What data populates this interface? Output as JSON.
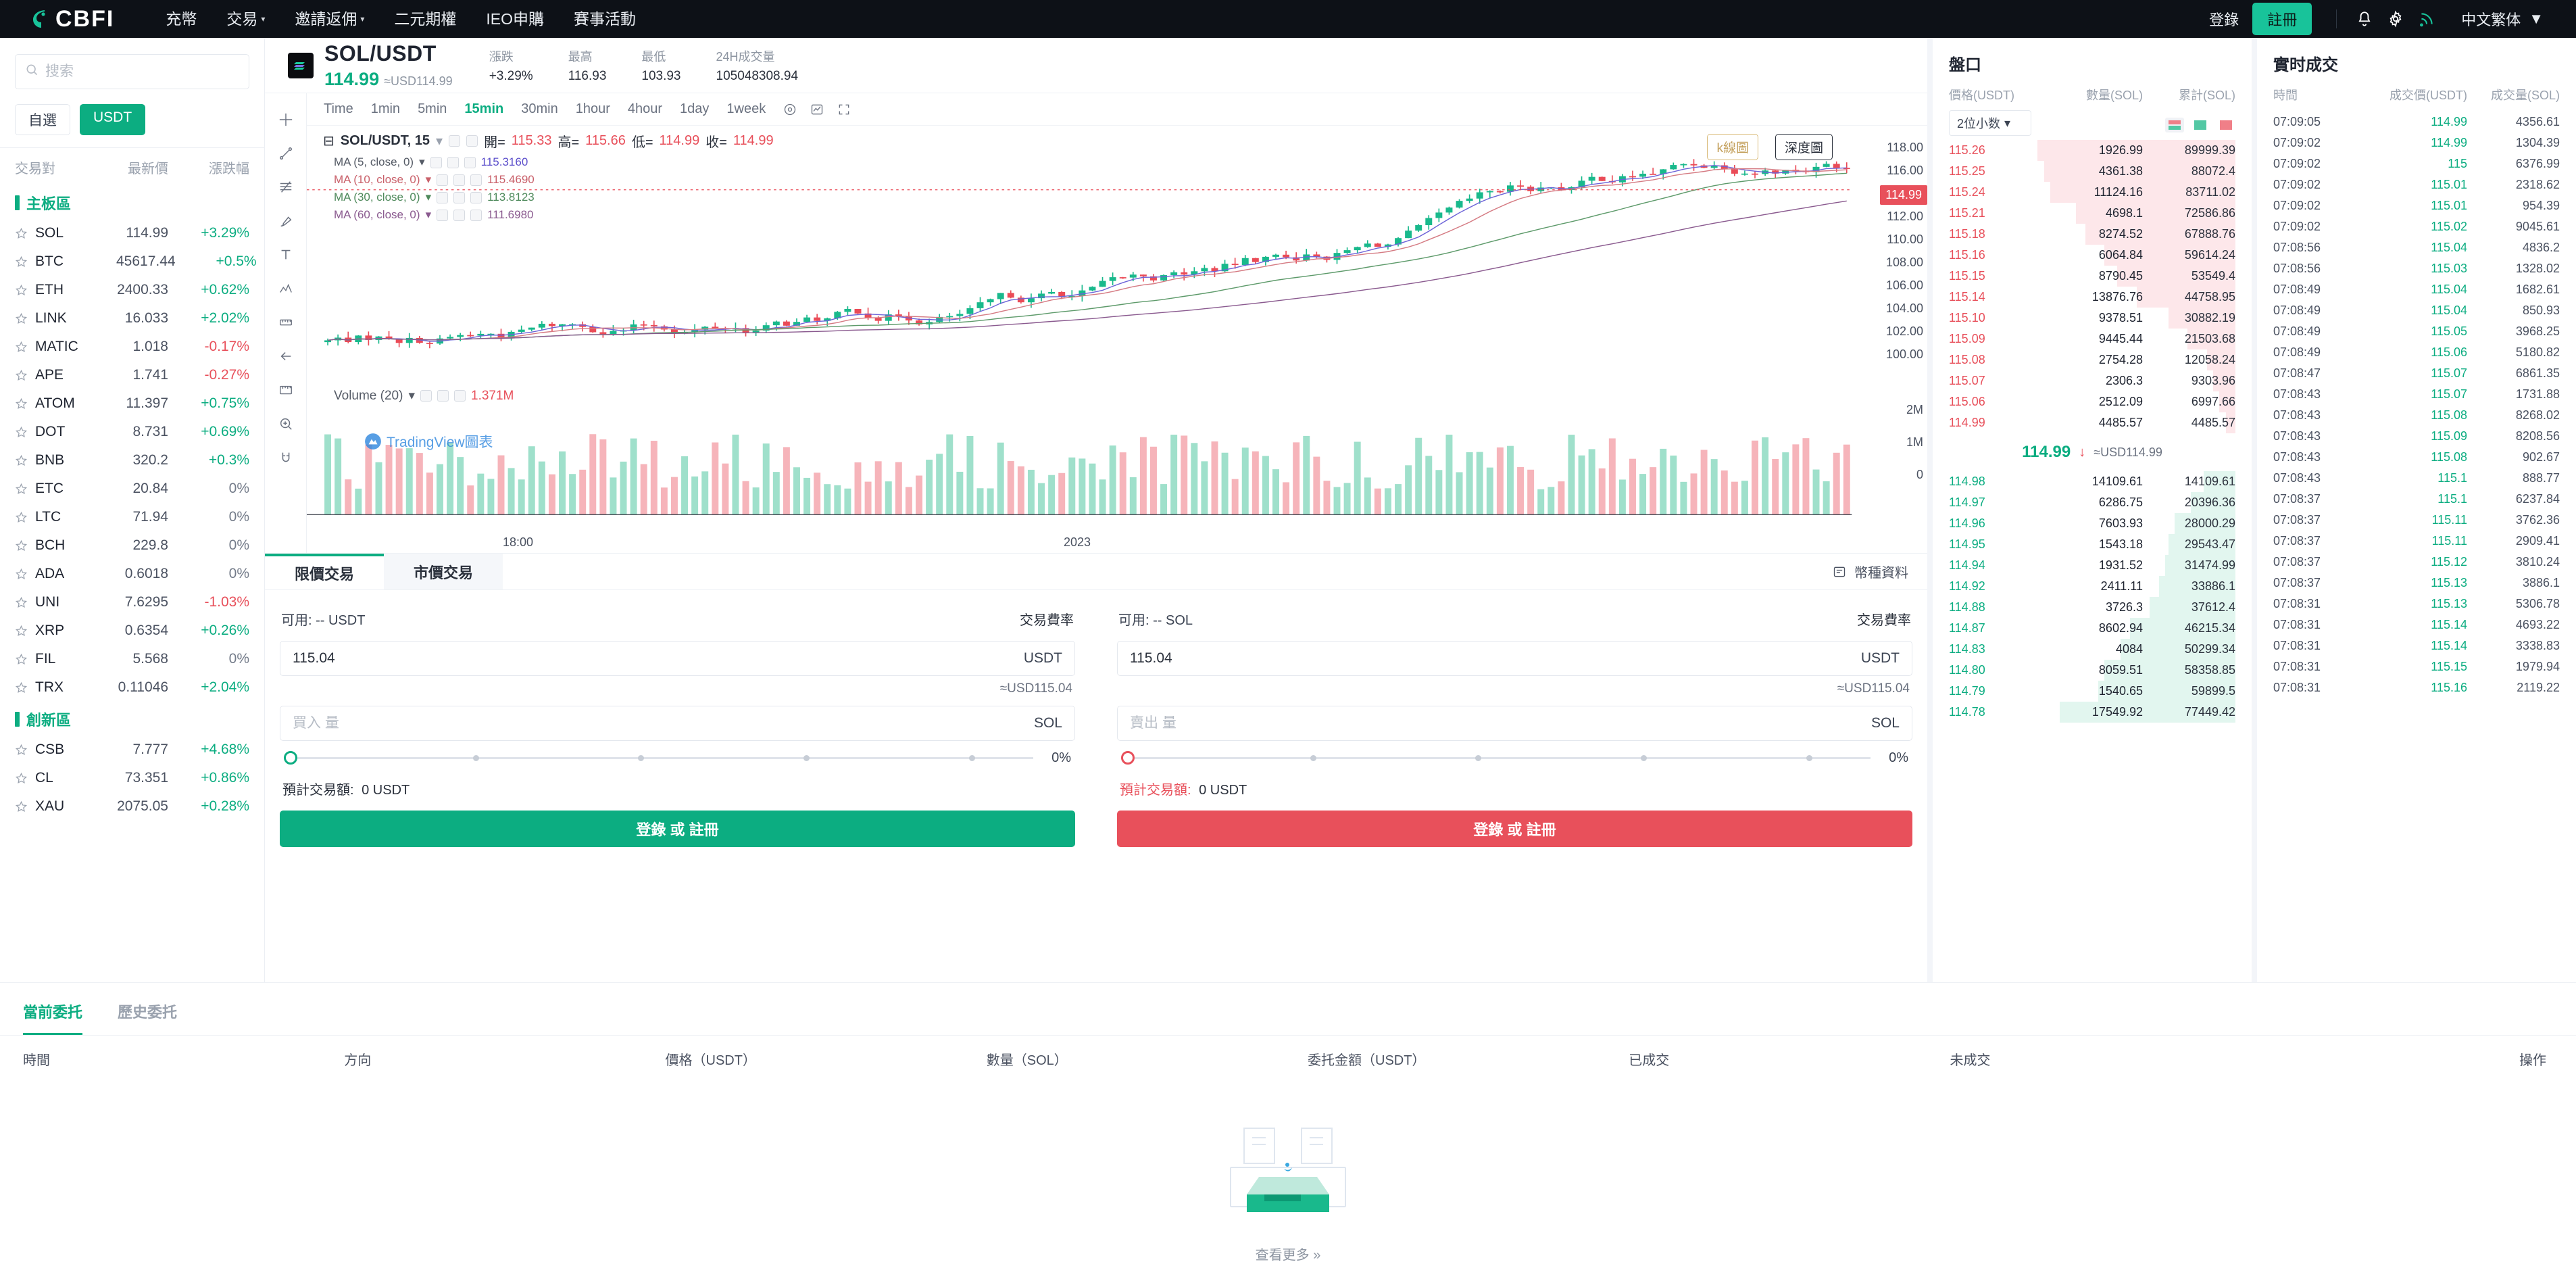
{
  "nav": {
    "brand": "CBFI",
    "items": [
      {
        "label": "充幣",
        "caret": false
      },
      {
        "label": "交易",
        "caret": true
      },
      {
        "label": "邀請返佣",
        "caret": true
      },
      {
        "label": "二元期權",
        "caret": false
      },
      {
        "label": "IEO申購",
        "caret": false
      },
      {
        "label": "賽事活動",
        "caret": false
      }
    ],
    "login": "登錄",
    "register": "註冊",
    "language": "中文繁体",
    "icons": [
      "bell-icon",
      "gear-icon",
      "rss-icon"
    ]
  },
  "sidebar": {
    "search_placeholder": "搜索",
    "chips": [
      {
        "label": "自選",
        "active": false
      },
      {
        "label": "USDT",
        "active": true
      }
    ],
    "columns": {
      "pair": "交易對",
      "price": "最新價",
      "change": "漲跌幅"
    },
    "groups": [
      {
        "name": "主板區",
        "coins": [
          {
            "symbol": "SOL",
            "price": "114.99",
            "change": "+3.29%",
            "dir": "up"
          },
          {
            "symbol": "BTC",
            "price": "45617.44",
            "change": "+0.5%",
            "dir": "up"
          },
          {
            "symbol": "ETH",
            "price": "2400.33",
            "change": "+0.62%",
            "dir": "up"
          },
          {
            "symbol": "LINK",
            "price": "16.033",
            "change": "+2.02%",
            "dir": "up"
          },
          {
            "symbol": "MATIC",
            "price": "1.018",
            "change": "-0.17%",
            "dir": "down"
          },
          {
            "symbol": "APE",
            "price": "1.741",
            "change": "-0.27%",
            "dir": "down"
          },
          {
            "symbol": "ATOM",
            "price": "11.397",
            "change": "+0.75%",
            "dir": "up"
          },
          {
            "symbol": "DOT",
            "price": "8.731",
            "change": "+0.69%",
            "dir": "up"
          },
          {
            "symbol": "BNB",
            "price": "320.2",
            "change": "+0.3%",
            "dir": "up"
          },
          {
            "symbol": "ETC",
            "price": "20.84",
            "change": "0%",
            "dir": "flat"
          },
          {
            "symbol": "LTC",
            "price": "71.94",
            "change": "0%",
            "dir": "flat"
          },
          {
            "symbol": "BCH",
            "price": "229.8",
            "change": "0%",
            "dir": "flat"
          },
          {
            "symbol": "ADA",
            "price": "0.6018",
            "change": "0%",
            "dir": "flat"
          },
          {
            "symbol": "UNI",
            "price": "7.6295",
            "change": "-1.03%",
            "dir": "down"
          },
          {
            "symbol": "XRP",
            "price": "0.6354",
            "change": "+0.26%",
            "dir": "up"
          },
          {
            "symbol": "FIL",
            "price": "5.568",
            "change": "0%",
            "dir": "flat"
          },
          {
            "symbol": "TRX",
            "price": "0.11046",
            "change": "+2.04%",
            "dir": "up"
          }
        ]
      },
      {
        "name": "創新區",
        "coins": [
          {
            "symbol": "CSB",
            "price": "7.777",
            "change": "+4.68%",
            "dir": "up"
          },
          {
            "symbol": "CL",
            "price": "73.351",
            "change": "+0.86%",
            "dir": "up"
          },
          {
            "symbol": "XAU",
            "price": "2075.05",
            "change": "+0.28%",
            "dir": "up"
          }
        ]
      }
    ]
  },
  "ticker": {
    "pair": "SOL/USDT",
    "price": "114.99",
    "approx": "≈USD114.99",
    "stats": [
      {
        "label": "漲跌",
        "value": "+3.29%",
        "dir": "up"
      },
      {
        "label": "最高",
        "value": "116.93",
        "dir": "plain"
      },
      {
        "label": "最低",
        "value": "103.93",
        "dir": "plain"
      },
      {
        "label": "24H成交量",
        "value": "105048308.94",
        "dir": "plain"
      }
    ]
  },
  "chart": {
    "timeframes": [
      {
        "label": "Time",
        "active": false
      },
      {
        "label": "1min",
        "active": false
      },
      {
        "label": "5min",
        "active": false
      },
      {
        "label": "15min",
        "active": true
      },
      {
        "label": "30min",
        "active": false
      },
      {
        "label": "1hour",
        "active": false
      },
      {
        "label": "4hour",
        "active": false
      },
      {
        "label": "1day",
        "active": false
      },
      {
        "label": "1week",
        "active": false
      }
    ],
    "symbol_label": "SOL/USDT, 15",
    "ohlc": {
      "open_label": "開=",
      "open": "115.33",
      "high_label": "高=",
      "high": "115.66",
      "low_label": "低=",
      "low": "114.99",
      "close_label": "收=",
      "close": "114.99"
    },
    "ma": [
      {
        "label": "MA (5, close, 0)",
        "value": "115.3160"
      },
      {
        "label": "MA (10, close, 0)",
        "value": "115.4690"
      },
      {
        "label": "MA (30, close, 0)",
        "value": "113.8123"
      },
      {
        "label": "MA (60, close, 0)",
        "value": "111.6980"
      }
    ],
    "volume": {
      "label": "Volume (20)",
      "value": "1.371M"
    },
    "watermark": "TradingView圖表",
    "kline_btn": "k線圖",
    "depth_btn": "深度圖",
    "price_ticks": [
      "118.00",
      "116.00",
      "114.00",
      "112.00",
      "110.00",
      "108.00",
      "106.00",
      "104.00",
      "102.00",
      "100.00"
    ],
    "current_price_tag": "114.99",
    "volume_ticks": [
      "2M",
      "1M",
      "0"
    ],
    "time_ticks": [
      "18:00",
      "2023"
    ]
  },
  "trade": {
    "tabs": [
      {
        "label": "限價交易",
        "active": true
      },
      {
        "label": "市價交易",
        "active": false
      }
    ],
    "fee_link": "幣種資料",
    "buy": {
      "avail_label": "可用: -- USDT",
      "fee_label": "交易費率",
      "price_value": "115.04",
      "price_unit": "USDT",
      "approx": "≈USD115.04",
      "amount_placeholder": "買入 量",
      "amount_unit": "SOL",
      "pct": "0%",
      "est_label": "預計交易額:",
      "est_value": "0 USDT",
      "cta": "登錄 或 註冊"
    },
    "sell": {
      "avail_label": "可用: -- SOL",
      "fee_label": "交易費率",
      "price_value": "115.04",
      "price_unit": "USDT",
      "approx": "≈USD115.04",
      "amount_placeholder": "賣出 量",
      "amount_unit": "SOL",
      "pct": "0%",
      "est_label": "預計交易額:",
      "est_value": "0 USDT",
      "cta": "登錄 或 註冊"
    }
  },
  "orderbook": {
    "title": "盤口",
    "columns": {
      "price": "價格(USDT)",
      "amount": "數量(SOL)",
      "total": "累計(SOL)"
    },
    "precision": "2位小数",
    "asks": [
      {
        "price": "115.26",
        "amount": "1926.99",
        "total": "89999.39",
        "w": 62
      },
      {
        "price": "115.25",
        "amount": "4361.38",
        "total": "88072.4",
        "w": 60
      },
      {
        "price": "115.24",
        "amount": "11124.16",
        "total": "83711.02",
        "w": 58
      },
      {
        "price": "115.21",
        "amount": "4698.1",
        "total": "72586.86",
        "w": 50
      },
      {
        "price": "115.18",
        "amount": "8274.52",
        "total": "67888.76",
        "w": 47
      },
      {
        "price": "115.16",
        "amount": "6064.84",
        "total": "59614.24",
        "w": 41
      },
      {
        "price": "115.15",
        "amount": "8790.45",
        "total": "53549.4",
        "w": 37
      },
      {
        "price": "115.14",
        "amount": "13876.76",
        "total": "44758.95",
        "w": 31
      },
      {
        "price": "115.10",
        "amount": "9378.51",
        "total": "30882.19",
        "w": 21
      },
      {
        "price": "115.09",
        "amount": "9445.44",
        "total": "21503.68",
        "w": 15
      },
      {
        "price": "115.08",
        "amount": "2754.28",
        "total": "12058.24",
        "w": 9
      },
      {
        "price": "115.07",
        "amount": "2306.3",
        "total": "9303.96",
        "w": 7
      },
      {
        "price": "115.06",
        "amount": "2512.09",
        "total": "6997.66",
        "w": 5
      },
      {
        "price": "114.99",
        "amount": "4485.57",
        "total": "4485.57",
        "w": 3
      }
    ],
    "mid": {
      "price": "114.99",
      "approx": "≈USD114.99"
    },
    "bids": [
      {
        "price": "114.98",
        "amount": "14109.61",
        "total": "14109.61",
        "w": 10
      },
      {
        "price": "114.97",
        "amount": "6286.75",
        "total": "20396.36",
        "w": 14
      },
      {
        "price": "114.96",
        "amount": "7603.93",
        "total": "28000.29",
        "w": 19
      },
      {
        "price": "114.95",
        "amount": "1543.18",
        "total": "29543.47",
        "w": 21
      },
      {
        "price": "114.94",
        "amount": "1931.52",
        "total": "31474.99",
        "w": 22
      },
      {
        "price": "114.92",
        "amount": "2411.11",
        "total": "33886.1",
        "w": 24
      },
      {
        "price": "114.88",
        "amount": "3726.3",
        "total": "37612.4",
        "w": 27
      },
      {
        "price": "114.87",
        "amount": "8602.94",
        "total": "46215.34",
        "w": 33
      },
      {
        "price": "114.83",
        "amount": "4084",
        "total": "50299.34",
        "w": 36
      },
      {
        "price": "114.80",
        "amount": "8059.51",
        "total": "58358.85",
        "w": 41
      },
      {
        "price": "114.79",
        "amount": "1540.65",
        "total": "59899.5",
        "w": 43
      },
      {
        "price": "114.78",
        "amount": "17549.92",
        "total": "77449.42",
        "w": 55
      }
    ]
  },
  "trades": {
    "title": "實时成交",
    "columns": {
      "time": "時間",
      "price": "成交價(USDT)",
      "amount": "成交量(SOL)"
    },
    "rows": [
      {
        "time": "07:09:05",
        "price": "114.99",
        "amount": "4356.61",
        "dir": "up"
      },
      {
        "time": "07:09:02",
        "price": "114.99",
        "amount": "1304.39",
        "dir": "up"
      },
      {
        "time": "07:09:02",
        "price": "115",
        "amount": "6376.99",
        "dir": "up"
      },
      {
        "time": "07:09:02",
        "price": "115.01",
        "amount": "2318.62",
        "dir": "up"
      },
      {
        "time": "07:09:02",
        "price": "115.01",
        "amount": "954.39",
        "dir": "up"
      },
      {
        "time": "07:09:02",
        "price": "115.02",
        "amount": "9045.61",
        "dir": "up"
      },
      {
        "time": "07:08:56",
        "price": "115.04",
        "amount": "4836.2",
        "dir": "up"
      },
      {
        "time": "07:08:56",
        "price": "115.03",
        "amount": "1328.02",
        "dir": "up"
      },
      {
        "time": "07:08:49",
        "price": "115.04",
        "amount": "1682.61",
        "dir": "up"
      },
      {
        "time": "07:08:49",
        "price": "115.04",
        "amount": "850.93",
        "dir": "up"
      },
      {
        "time": "07:08:49",
        "price": "115.05",
        "amount": "3968.25",
        "dir": "up"
      },
      {
        "time": "07:08:49",
        "price": "115.06",
        "amount": "5180.82",
        "dir": "up"
      },
      {
        "time": "07:08:47",
        "price": "115.07",
        "amount": "6861.35",
        "dir": "up"
      },
      {
        "time": "07:08:43",
        "price": "115.07",
        "amount": "1731.88",
        "dir": "up"
      },
      {
        "time": "07:08:43",
        "price": "115.08",
        "amount": "8268.02",
        "dir": "up"
      },
      {
        "time": "07:08:43",
        "price": "115.09",
        "amount": "8208.56",
        "dir": "up"
      },
      {
        "time": "07:08:43",
        "price": "115.08",
        "amount": "902.67",
        "dir": "up"
      },
      {
        "time": "07:08:43",
        "price": "115.1",
        "amount": "888.77",
        "dir": "up"
      },
      {
        "time": "07:08:37",
        "price": "115.1",
        "amount": "6237.84",
        "dir": "up"
      },
      {
        "time": "07:08:37",
        "price": "115.11",
        "amount": "3762.36",
        "dir": "up"
      },
      {
        "time": "07:08:37",
        "price": "115.11",
        "amount": "2909.41",
        "dir": "up"
      },
      {
        "time": "07:08:37",
        "price": "115.12",
        "amount": "3810.24",
        "dir": "up"
      },
      {
        "time": "07:08:37",
        "price": "115.13",
        "amount": "3886.1",
        "dir": "up"
      },
      {
        "time": "07:08:31",
        "price": "115.13",
        "amount": "5306.78",
        "dir": "up"
      },
      {
        "time": "07:08:31",
        "price": "115.14",
        "amount": "4693.22",
        "dir": "up"
      },
      {
        "time": "07:08:31",
        "price": "115.14",
        "amount": "3338.83",
        "dir": "up"
      },
      {
        "time": "07:08:31",
        "price": "115.15",
        "amount": "1979.94",
        "dir": "up"
      },
      {
        "time": "07:08:31",
        "price": "115.16",
        "amount": "2119.22",
        "dir": "up"
      }
    ]
  },
  "orders": {
    "tabs": [
      {
        "label": "當前委托",
        "active": true
      },
      {
        "label": "歷史委托",
        "active": false
      }
    ],
    "columns": [
      "時間",
      "方向",
      "價格（USDT）",
      "數量（SOL）",
      "委托金額（USDT）",
      "已成交",
      "未成交",
      "操作"
    ],
    "empty_more": "查看更多 »"
  }
}
